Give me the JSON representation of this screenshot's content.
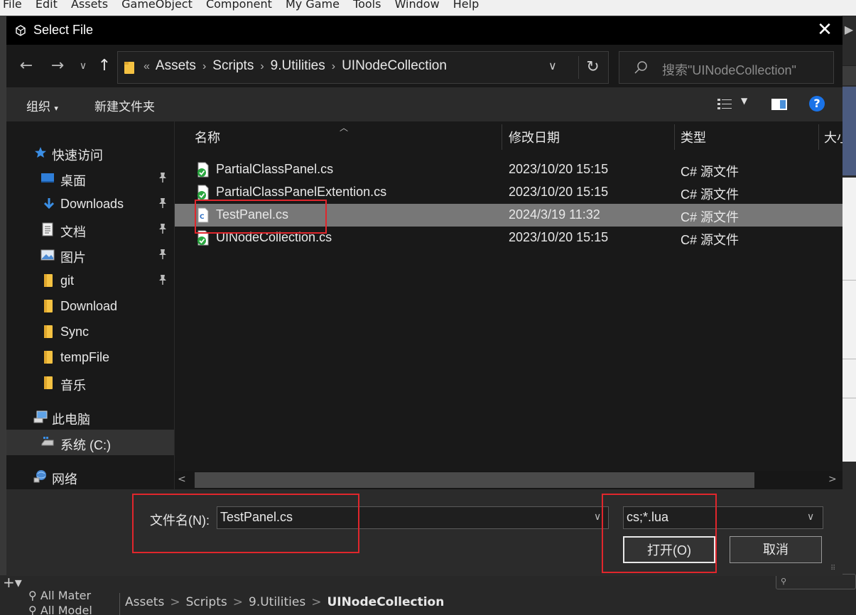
{
  "unity": {
    "menu": [
      "File",
      "Edit",
      "Assets",
      "GameObject",
      "Component",
      "My Game",
      "Tools",
      "Window",
      "Help"
    ],
    "project_list": [
      "All Mater",
      "All Model"
    ],
    "breadcrumb": [
      "Assets",
      "Scripts",
      "9.Utilities",
      "UINodeCollection"
    ]
  },
  "dialog": {
    "title": "Select File",
    "address": {
      "overflow": "«",
      "crumbs": [
        "Assets",
        "Scripts",
        "9.Utilities",
        "UINodeCollection"
      ]
    },
    "search": {
      "placeholder": "搜索\"UINodeCollection\""
    },
    "toolbar": {
      "organize": "组织",
      "new_folder": "新建文件夹"
    },
    "sidebar": {
      "quick_access": "快速访问",
      "items": [
        {
          "label": "桌面",
          "icon": "desktop-icon",
          "pinned": true
        },
        {
          "label": "Downloads",
          "icon": "download-arrow-icon",
          "pinned": true
        },
        {
          "label": "文档",
          "icon": "document-icon",
          "pinned": true
        },
        {
          "label": "图片",
          "icon": "pictures-icon",
          "pinned": true
        },
        {
          "label": "git",
          "icon": "folder-icon",
          "pinned": true
        },
        {
          "label": "Download",
          "icon": "folder-icon",
          "pinned": false
        },
        {
          "label": "Sync",
          "icon": "folder-icon",
          "pinned": false
        },
        {
          "label": "tempFile",
          "icon": "folder-icon",
          "pinned": false
        },
        {
          "label": "音乐",
          "icon": "folder-icon",
          "pinned": false
        }
      ],
      "this_pc": "此电脑",
      "drive": "系统 (C:)",
      "network": "网络"
    },
    "columns": {
      "name": "名称",
      "modified": "修改日期",
      "type": "类型",
      "size": "大小"
    },
    "files": [
      {
        "name": "PartialClassPanel.cs",
        "date": "2023/10/20 15:15",
        "type": "C# 源文件",
        "selected": false
      },
      {
        "name": "PartialClassPanelExtention.cs",
        "date": "2023/10/20 15:15",
        "type": "C# 源文件",
        "selected": false
      },
      {
        "name": "TestPanel.cs",
        "date": "2024/3/19 11:32",
        "type": "C# 源文件",
        "selected": true
      },
      {
        "name": "UINodeCollection.cs",
        "date": "2023/10/20 15:15",
        "type": "C# 源文件",
        "selected": false
      }
    ],
    "filename_label": "文件名(N):",
    "filename_value": "TestPanel.cs",
    "filter_value": "cs;*.lua",
    "open_button": "打开(O)",
    "cancel_button": "取消"
  },
  "colors": {
    "selected_row": "#777777",
    "annotation_red": "#e0262c",
    "help_blue": "#1a73e8"
  }
}
